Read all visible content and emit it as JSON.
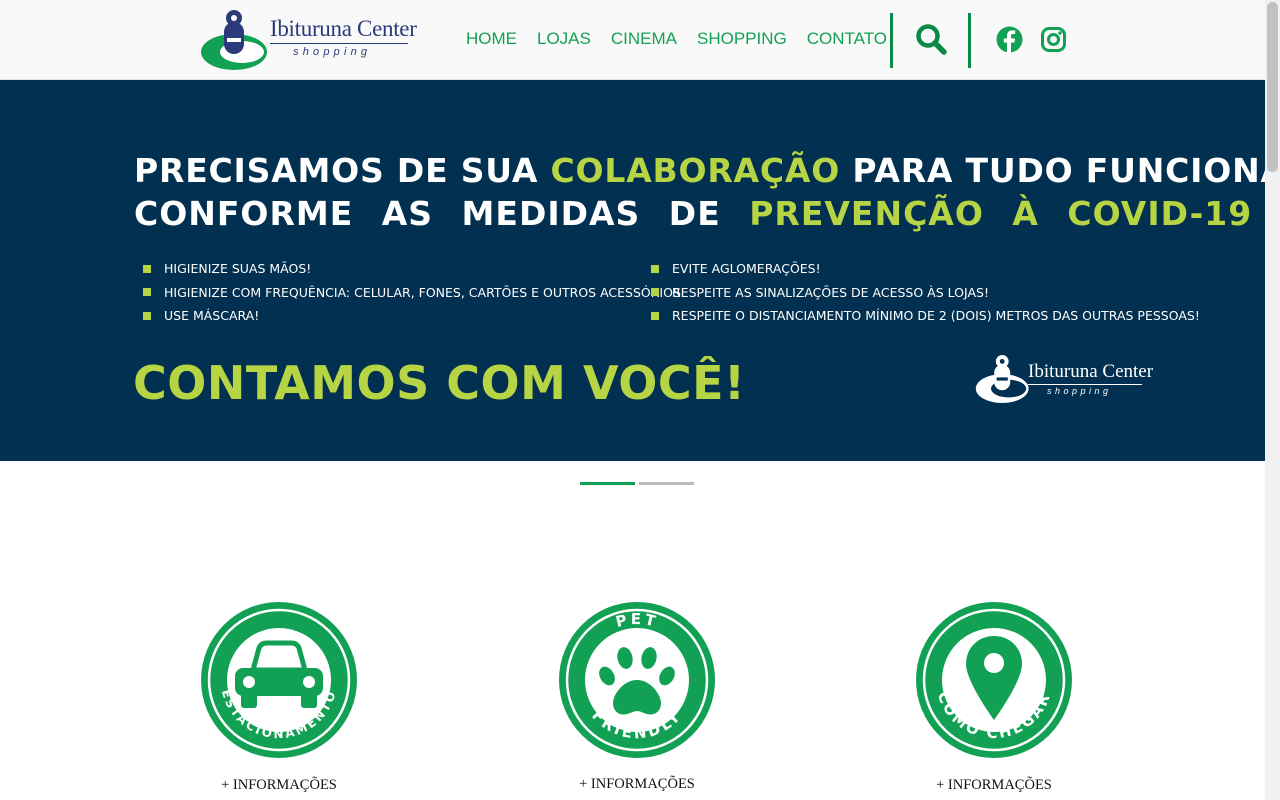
{
  "brand": {
    "name": "Ibituruna Center",
    "sub": "shopping",
    "green": "#12a154",
    "navy": "#023050",
    "lime": "#b6d443"
  },
  "nav": {
    "items": [
      "HOME",
      "LOJAS",
      "CINEMA",
      "SHOPPING",
      "CONTATO"
    ],
    "search_icon": "search-icon",
    "social": [
      "facebook-icon",
      "instagram-icon"
    ]
  },
  "banner": {
    "line1_a": "PRECISAMOS DE SUA ",
    "line1_b": "COLABORAÇÃO",
    "line1_c": " PARA TUDO FUNCIONAR",
    "line2_a": "CONFORME AS MEDIDAS DE ",
    "line2_b": "PREVENÇÃO À COVID-19",
    "bullets_left": [
      "HIGIENIZE SUAS MÃOS!",
      "HIGIENIZE COM FREQUÊNCIA: CELULAR, FONES, CARTÕES E OUTROS ACESSÓRIOS.",
      "USE MÁSCARA!"
    ],
    "bullets_right": [
      "EVITE AGLOMERAÇÕES!",
      "RESPEITE AS SINALIZAÇÕES DE ACESSO ÀS LOJAS!",
      "RESPEITE O DISTANCIAMENTO MÍNIMO DE 2 (DOIS) METROS DAS OUTRAS PESSOAS!"
    ],
    "closing": "CONTAMOS COM VOCÊ!",
    "logo_name": "Ibituruna Center",
    "logo_sub": "shopping"
  },
  "carousel": {
    "slides": 2,
    "active": 1,
    "active_color": "#12a154",
    "inactive_color": "#bbbbbb"
  },
  "features": [
    {
      "name": "estacionamento",
      "ring_text": "ESTACIONAMENTO",
      "icon": "car-icon",
      "more": "+ INFORMAÇÕES"
    },
    {
      "name": "pet-friendly",
      "ring_top": "PET",
      "ring_bottom": "FRIENDLY",
      "icon": "paw-icon",
      "more": "+ INFORMAÇÕES"
    },
    {
      "name": "como-chegar",
      "ring_text": "COMO CHEGAR",
      "icon": "map-pin-icon",
      "more": "+ INFORMAÇÕES"
    }
  ]
}
